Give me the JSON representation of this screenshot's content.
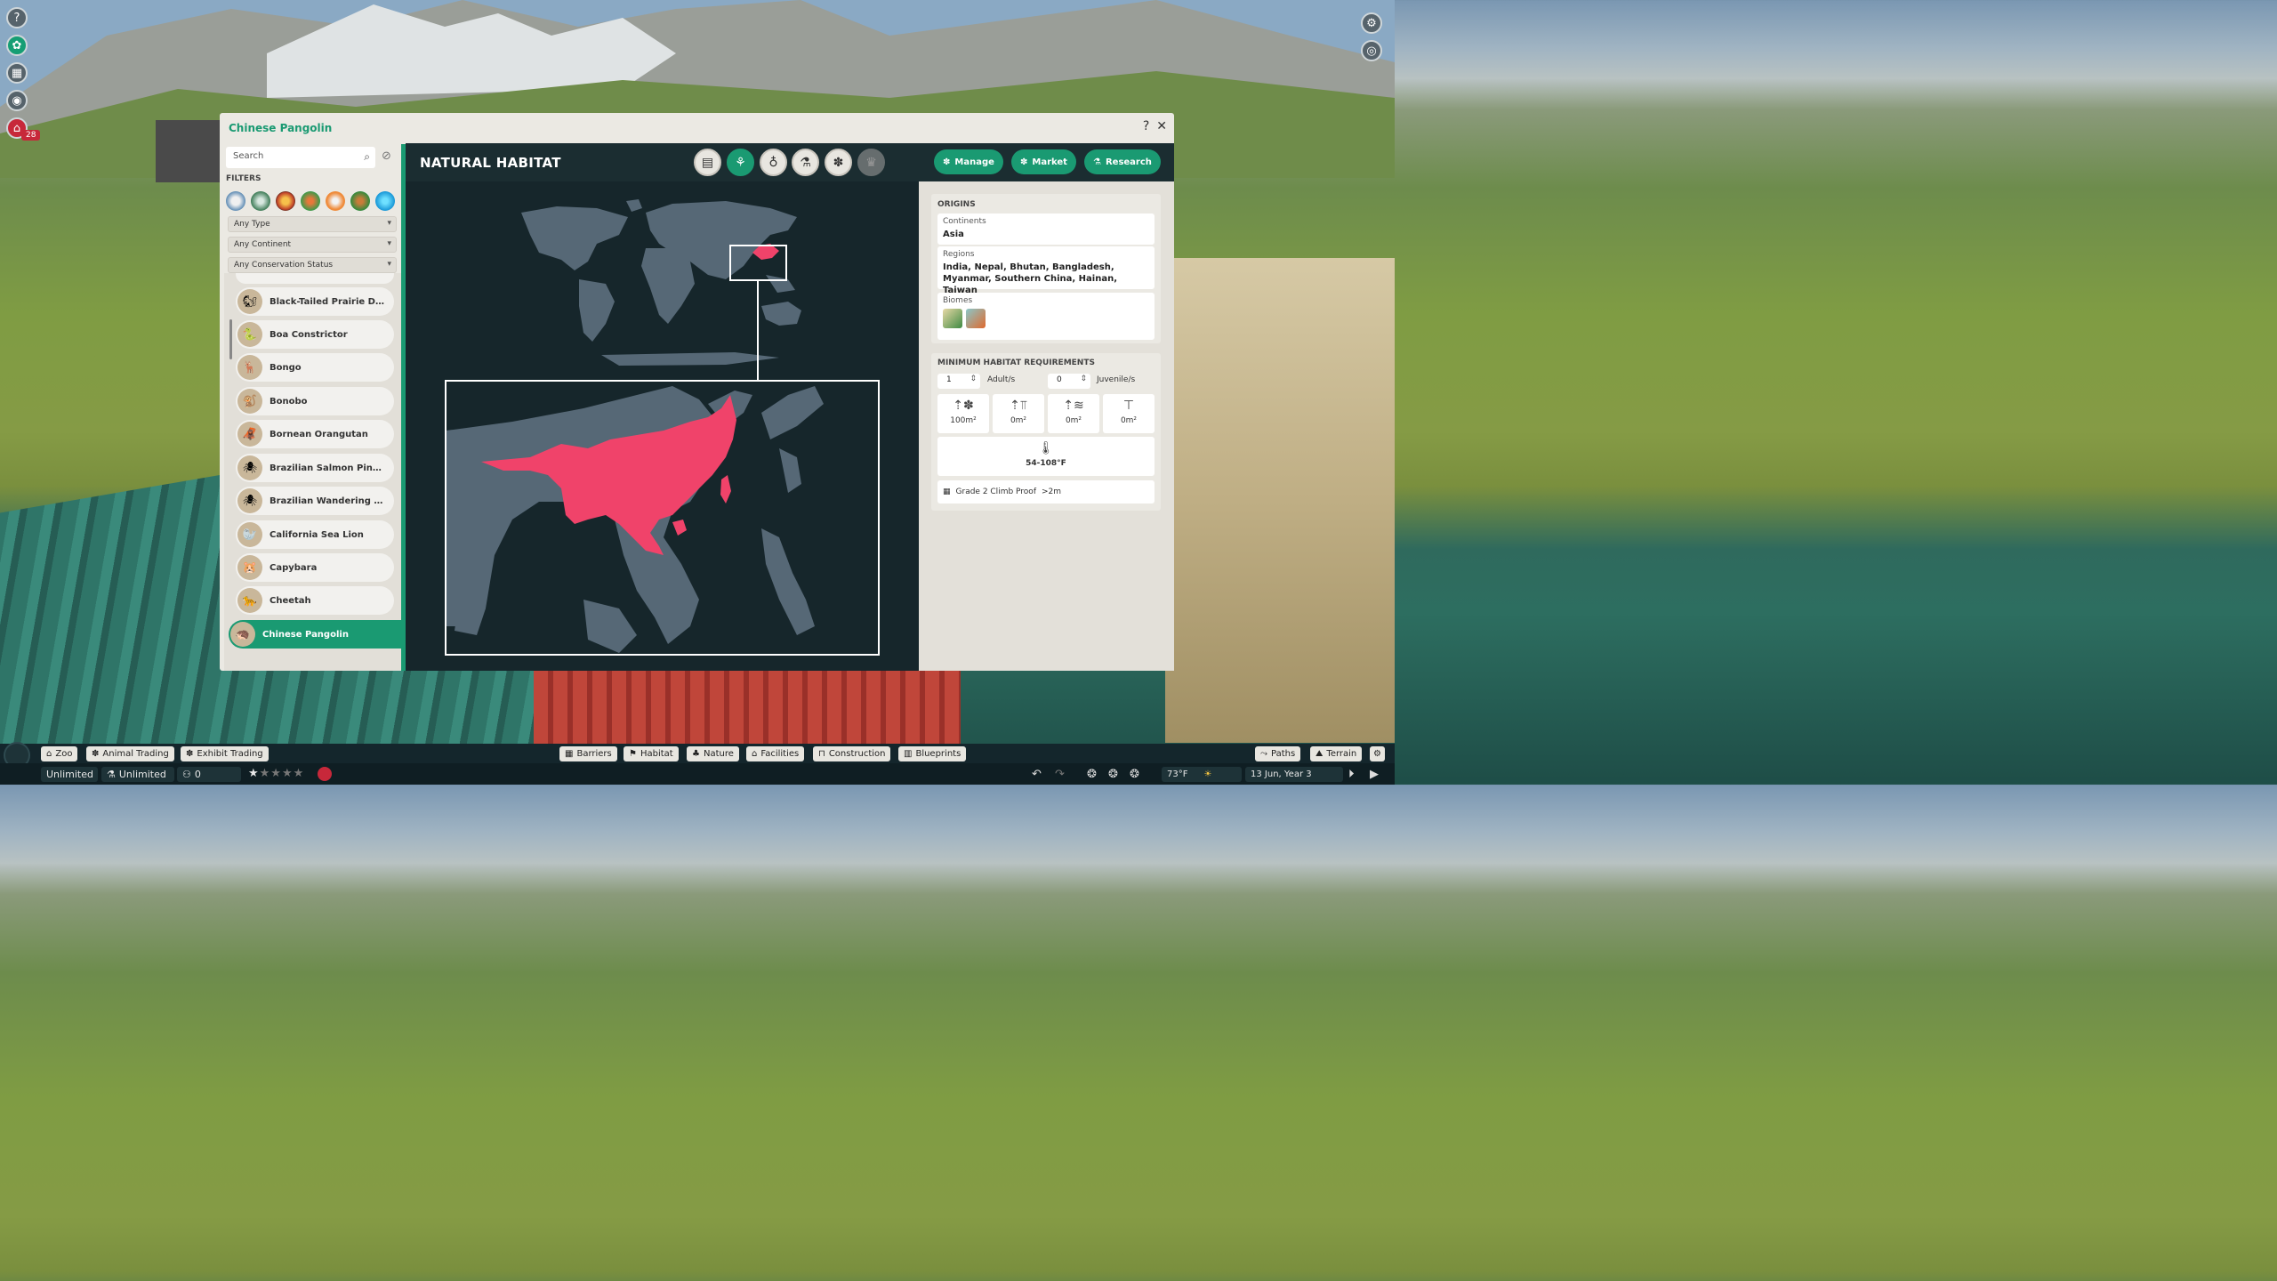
{
  "window": {
    "title": "Chinese Pangolin",
    "help_label": "?",
    "close_label": "✕"
  },
  "sidebar": {
    "search_placeholder": "Search",
    "filters_label": "FILTERS",
    "filter_icons": [
      "tundra-biome",
      "temperate-biome",
      "desert-biome",
      "tropical-biome",
      "grassland-biome",
      "continental-biome",
      "aquatic-biome"
    ],
    "type_dropdown": "Any Type",
    "continent_dropdown": "Any Continent",
    "status_dropdown": "Any Conservation Status",
    "animals": [
      {
        "name": "Black-Tailed Prairie Dog",
        "icon": "🐿"
      },
      {
        "name": "Boa Constrictor",
        "icon": "🐍"
      },
      {
        "name": "Bongo",
        "icon": "🦌"
      },
      {
        "name": "Bonobo",
        "icon": "🐒"
      },
      {
        "name": "Bornean Orangutan",
        "icon": "🦧"
      },
      {
        "name": "Brazilian Salmon Pink Tar...",
        "icon": "🕷"
      },
      {
        "name": "Brazilian Wandering Spider",
        "icon": "🕷"
      },
      {
        "name": "California Sea Lion",
        "icon": "🦭"
      },
      {
        "name": "Capybara",
        "icon": "🐹"
      },
      {
        "name": "Cheetah",
        "icon": "🐆"
      },
      {
        "name": "Chinese Pangolin",
        "icon": "🦔",
        "selected": true
      }
    ]
  },
  "header": {
    "title": "NATURAL HABITAT",
    "tabs": [
      "clipboard-icon",
      "habitat-icon",
      "enrichment-icon",
      "food-icon",
      "paw-icon",
      "trophy-icon"
    ],
    "manage_label": "Manage",
    "market_label": "Market",
    "research_label": "Research"
  },
  "origins": {
    "heading": "ORIGINS",
    "continents_label": "Continents",
    "continents_value": "Asia",
    "regions_label": "Regions",
    "regions_value": "India, Nepal, Bhutan, Bangladesh, Myanmar, Southern China, Hainan, Taiwan",
    "biomes_label": "Biomes",
    "biomes": [
      "tropical-biome",
      "temperate-biome"
    ]
  },
  "requirements": {
    "heading": "MINIMUM HABITAT REQUIREMENTS",
    "adults_value": "1",
    "adults_label": "Adult/s",
    "juveniles_value": "0",
    "juveniles_label": "Juvenile/s",
    "land_area": "100m²",
    "climbing_area": "0m²",
    "water_area": "0m²",
    "deep_water": "0m²",
    "temperature": "54-108°F",
    "barrier": "Grade 2 Climb Proof",
    "barrier_height": ">2m"
  },
  "notifications": {
    "count": "28"
  },
  "bottom_bar": {
    "zoo": "Zoo",
    "animal_trading": "Animal Trading",
    "exhibit_trading": "Exhibit Trading",
    "barriers": "Barriers",
    "habitat": "Habitat",
    "nature": "Nature",
    "facilities": "Facilities",
    "construction": "Construction",
    "blueprints": "Blueprints",
    "paths": "Paths",
    "terrain": "Terrain"
  },
  "status_bar": {
    "money": "Unlimited",
    "research": "Unlimited",
    "guests": "0",
    "temperature": "73°F",
    "date": "13 Jun, Year 3",
    "rating_stars": 1.5
  },
  "colors": {
    "accent": "#1a9a72",
    "range": "#f0436a",
    "land": "#566876",
    "ocean": "#16262b"
  }
}
